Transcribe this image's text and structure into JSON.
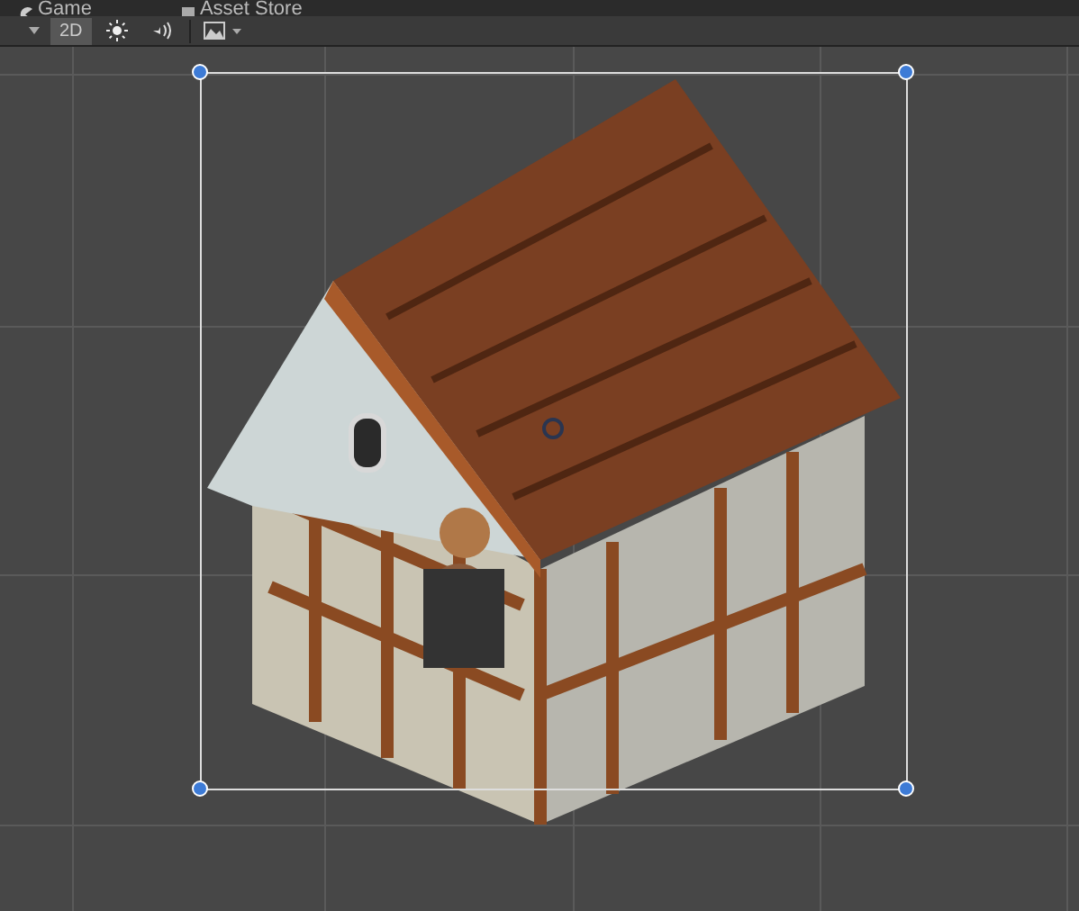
{
  "tabs": [
    {
      "label": "Game"
    },
    {
      "label": "Asset Store"
    }
  ],
  "toolbar": {
    "mode_2d": {
      "label": "2D",
      "on": true
    },
    "lighting": {
      "on": false
    },
    "audio": {
      "on": false
    }
  }
}
